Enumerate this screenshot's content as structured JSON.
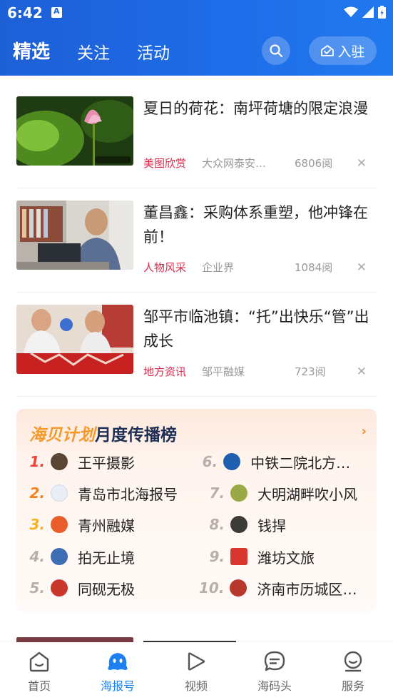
{
  "status_bar": {
    "time": "6:42"
  },
  "header": {
    "tabs": [
      {
        "label": "精选",
        "active": true
      },
      {
        "label": "关注",
        "active": false
      },
      {
        "label": "活动",
        "active": false
      }
    ],
    "search_icon": "search-icon",
    "join_label": "入驻"
  },
  "articles": [
    {
      "title": "夏日的荷花：南坪荷塘的限定浪漫",
      "category": "美图欣赏",
      "source": "大众网泰安拍客频道",
      "reads": "6806阅",
      "close": "✕"
    },
    {
      "title": "董昌鑫：采购体系重塑，他冲锋在前！",
      "category": "人物风采",
      "source": "企业界",
      "reads": "1084阅",
      "close": "✕"
    },
    {
      "title": "邹平市临池镇：“托”出快乐“管”出成长",
      "category": "地方资讯",
      "source": "邹平融媒",
      "reads": "723阅",
      "close": "✕"
    }
  ],
  "ranking": {
    "title_brand": "海贝计划",
    "title_rest": "月度传播榜",
    "more": "›",
    "items": [
      {
        "rank": "1.",
        "name": "王平摄影",
        "color": "#5b4636"
      },
      {
        "rank": "2.",
        "name": "青岛市北海报号",
        "color": "#e9eef6"
      },
      {
        "rank": "3.",
        "name": "青州融媒",
        "color": "#e85d2a"
      },
      {
        "rank": "4.",
        "name": "拍无止境",
        "color": "#3d6db5"
      },
      {
        "rank": "5.",
        "name": "同砚无极",
        "color": "#c8362c"
      },
      {
        "rank": "6.",
        "name": "中铁二院北方勘察设计院",
        "color": "#1f5fb0"
      },
      {
        "rank": "7.",
        "name": "大明湖畔吹小风",
        "color": "#9aa845"
      },
      {
        "rank": "8.",
        "name": "钱捍",
        "color": "#3c3a36"
      },
      {
        "rank": "9.",
        "name": "潍坊文旅",
        "color": "#d8372e"
      },
      {
        "rank": "10.",
        "name": "济南市历城区融媒体中心",
        "color": "#b7372a"
      }
    ]
  },
  "bottom_nav": [
    {
      "label": "首页",
      "icon": "home-icon",
      "active": false
    },
    {
      "label": "海报号",
      "icon": "mascot-icon",
      "active": true
    },
    {
      "label": "视频",
      "icon": "play-icon",
      "active": false
    },
    {
      "label": "海码头",
      "icon": "chat-icon",
      "active": false
    },
    {
      "label": "服务",
      "icon": "service-icon",
      "active": false
    }
  ],
  "colors": {
    "header": "#1e63dc",
    "accent_blue": "#1e80f0",
    "category_red": "#e0274d",
    "brand_orange": "#f59a2a"
  }
}
